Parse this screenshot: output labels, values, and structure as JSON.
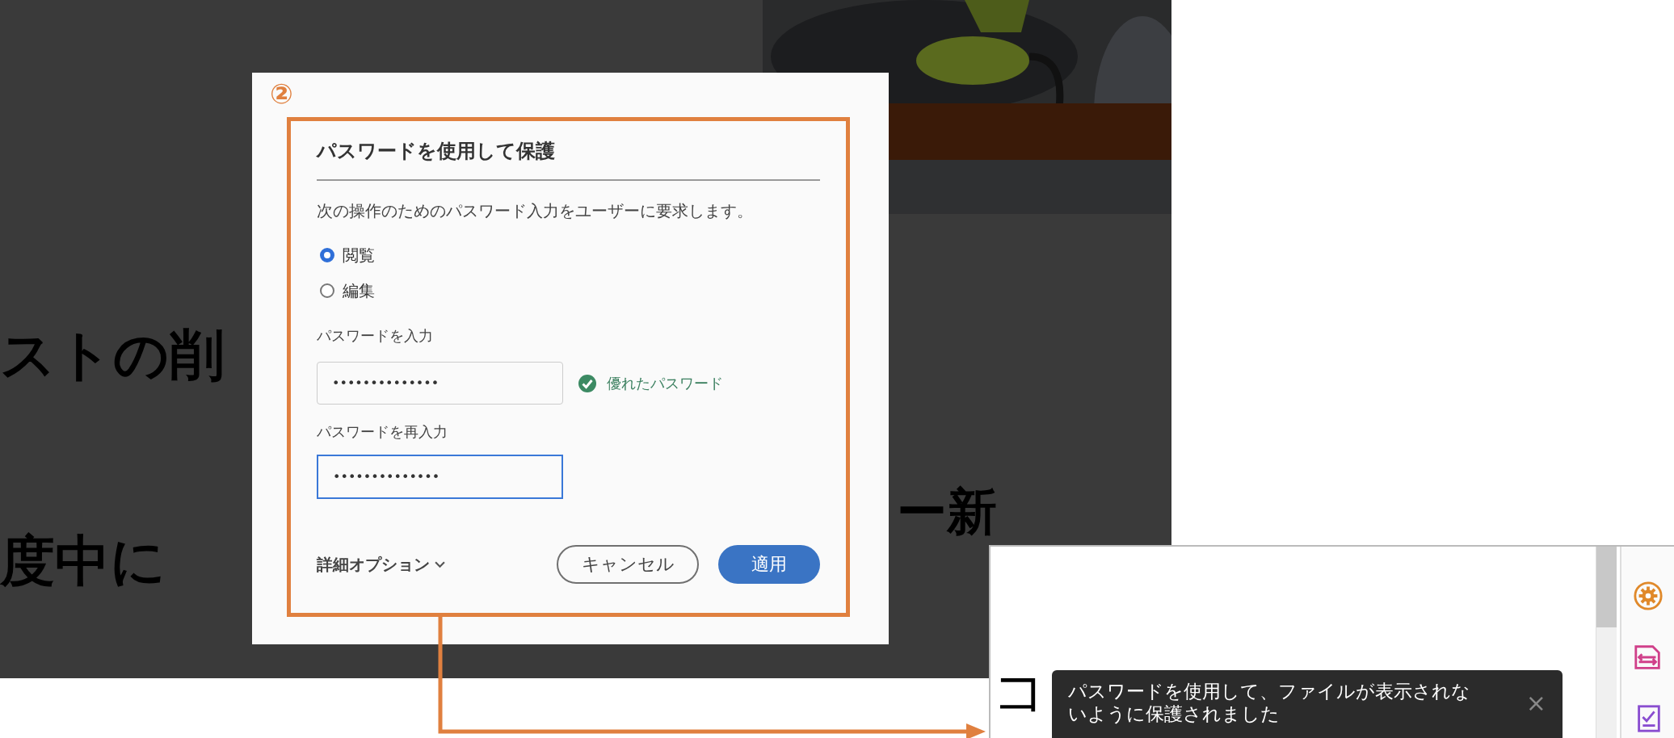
{
  "background_document": {
    "lines": [
      {
        "text": "ストの削"
      },
      {
        "text": "度中に"
      },
      {
        "text": "ー新"
      }
    ]
  },
  "dialog": {
    "step_marker": "②",
    "title": "パスワードを使用して保護",
    "description": "次の操作のためのパスワード入力をユーザーに要求します。",
    "options": [
      {
        "label": "閲覧",
        "selected": true
      },
      {
        "label": "編集",
        "selected": false
      }
    ],
    "password": {
      "label": "パスワードを入力",
      "value": "••••••••••••••",
      "focused": false
    },
    "strength": {
      "text": "優れたパスワード"
    },
    "confirm": {
      "label": "パスワードを再入力",
      "value": "••••••••••••••",
      "focused": true
    },
    "more_options": "詳細オプション",
    "buttons": [
      {
        "label": "キャンセル",
        "kind": "secondary"
      },
      {
        "label": "適用",
        "kind": "primary"
      }
    ]
  },
  "result_panel": {
    "document_glyph": "コ",
    "toast": {
      "text": "パスワードを使用して、ファイルが表示されないように保護されました",
      "close": "×"
    }
  }
}
